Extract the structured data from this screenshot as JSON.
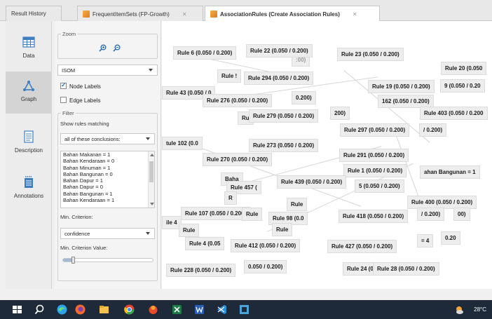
{
  "tabs": [
    {
      "label": "Result History",
      "active": false,
      "icon": "none"
    },
    {
      "label": "FrequentItemSets (FP-Growth)",
      "active": false,
      "icon": "results-icon"
    },
    {
      "label": "AssociationRules (Create Association Rules)",
      "active": true,
      "icon": "results-icon"
    }
  ],
  "leftnav": {
    "items": [
      {
        "label": "Data",
        "icon": "table-icon",
        "active": false
      },
      {
        "label": "Graph",
        "icon": "graph-icon",
        "active": true
      },
      {
        "label": "Description",
        "icon": "document-icon",
        "active": false
      },
      {
        "label": "Annotations",
        "icon": "annotations-icon",
        "active": false
      }
    ]
  },
  "panel": {
    "zoom_legend": "Zoom",
    "layout_value": "ISOM",
    "node_labels": {
      "label": "Node Labels",
      "checked": true
    },
    "edge_labels": {
      "label": "Edge Labels",
      "checked": false
    },
    "filter_legend": "Filter",
    "show_rules_label": "Show rules matching",
    "match_mode": "all of these conclusions:",
    "conclusions": [
      "Bahan Makanan = 1",
      "Bahan Kendaraan = 0",
      "Bahan Minuman = 1",
      "Bahan Bangunan = 0",
      "Bahan Dapur = 1",
      "Bahan Dapur = 0",
      "Bahan Bangunan = 1",
      "Bahan Kendaraan = 1"
    ],
    "min_criterion_label": "Min. Criterion:",
    "min_criterion_value": "confidence",
    "min_criterion_value_label": "Min. Criterion Value:",
    "slider_level": 0.12
  },
  "canvas": {
    "nodes": [
      "Rule 6 (0.050 / 0.200)",
      "Rule 22 (0.050 / 0.200)",
      "Rule 23 (0.050 / 0.200)",
      "Rule 20 (0.050",
      "Rule 294 (0.050 / 0.200)",
      "Rule 19 (0.050 / 0.200)",
      "9 (0.050 / 0.20",
      "Rule 43 (0.050 / 0",
      "Rule 276 (0.050 / 0.200)",
      "162 (0.050 / 0.200)",
      "Rule 279 (0.050 / 0.200)",
      "Rule 403 (0.050 / 0.200",
      "Rule 297 (0.050 / 0.200)",
      "tule 102 (0.0",
      "Rule 273 (0.050 / 0.200)",
      "Rule 270 (0.050 / 0.200)",
      "Rule 291 (0.050 / 0.200)",
      "Rule 1 (0.050 / 0.200)",
      "Rule 457 (",
      "Rule 439 (0.050 / 0.200)",
      "5 (0.050 / 0.200)",
      "ahan Bangunan = 1",
      "Rule 107 (0.050 / 0.200)",
      "Rule 98 (0.0",
      "Rule 418 (0.050 / 0.200)",
      "Rule 400 (0.050 / 0.200)",
      "Rule 4 (0.05",
      "Rule 412 (0.050 / 0.200)",
      "Rule 427 (0.050 / 0.200)",
      "Rule 228 (0.050 / 0.200)",
      "0.050 / 0.200)",
      "Rule 24 (0.0",
      "Rule 28 (0.050 / 0.200)",
      "Rule",
      "Rule",
      "Rule",
      "Rule",
      "Baha",
      "ile 4",
      "/ 0.200)",
      "00)",
      "0.20",
      "/ 0.200)",
      "200)",
      "0.200)",
      "= 4",
      "Rule !",
      "Ru",
      "R",
      ":00)"
    ]
  },
  "taskbar": {
    "weather": "28°C",
    "icons": [
      "windows-start-icon",
      "search-icon",
      "edge-browser-icon",
      "firefox-icon",
      "file-explorer-icon",
      "chrome-icon",
      "app-icon",
      "excel-icon",
      "word-icon",
      "vscode-icon",
      "rapidminer-icon"
    ]
  }
}
